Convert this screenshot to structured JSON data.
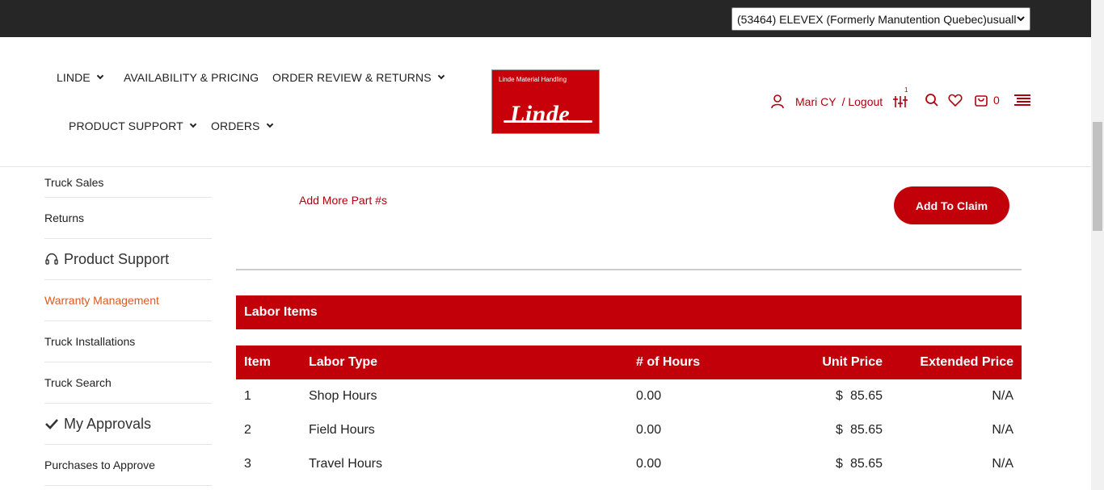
{
  "account": {
    "selected": "(53464) ELEVEX (Formerly Manutention Quebec)usuall"
  },
  "nav": {
    "items": [
      {
        "label": "LINDE"
      },
      {
        "label": "AVAILABILITY & PRICING"
      },
      {
        "label": "ORDER REVIEW & RETURNS"
      },
      {
        "label": "PRODUCT SUPPORT"
      },
      {
        "label": "ORDERS"
      }
    ]
  },
  "logo": {
    "tagline": "Linde Material Handling",
    "name": "Linde"
  },
  "user": {
    "name": "Mari CY",
    "logout": "/ Logout",
    "cart_count": "0",
    "compare_badge": "1"
  },
  "sidebar": {
    "items": [
      {
        "label": "Truck Sales"
      },
      {
        "label": "Returns"
      }
    ],
    "product_support_heading": "Product Support",
    "support_items": [
      {
        "label": "Warranty Management"
      },
      {
        "label": "Truck Installations"
      },
      {
        "label": "Truck Search"
      }
    ],
    "approvals_heading": "My Approvals",
    "approval_items": [
      {
        "label": "Purchases to Approve"
      }
    ]
  },
  "main": {
    "add_more_label": "Add More Part #s",
    "add_to_claim_label": "Add To Claim",
    "labor_section_title": "Labor Items",
    "labor_table": {
      "columns": [
        "Item",
        "Labor Type",
        "# of Hours",
        "Unit Price",
        "Extended Price"
      ],
      "currency_symbol": "$",
      "rows": [
        {
          "item": "1",
          "type": "Shop Hours",
          "hours": "0.00",
          "unit_price": "85.65",
          "extended": "N/A"
        },
        {
          "item": "2",
          "type": "Field Hours",
          "hours": "0.00",
          "unit_price": "85.65",
          "extended": "N/A"
        },
        {
          "item": "3",
          "type": "Travel Hours",
          "hours": "0.00",
          "unit_price": "85.65",
          "extended": "N/A"
        }
      ]
    }
  },
  "colors": {
    "brand_red": "#c1000a",
    "active_link": "#e0571f",
    "top_bar": "#262626"
  }
}
